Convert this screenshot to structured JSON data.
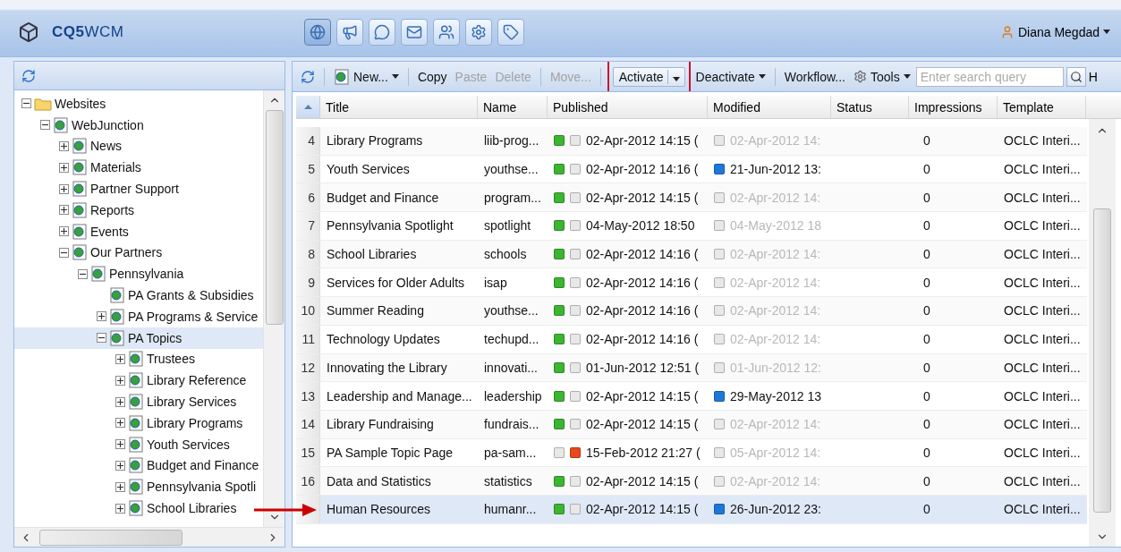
{
  "topbar": {
    "logo": "**CQ5**WCM",
    "apps": [
      {
        "selected": true
      },
      {
        "selected": false
      },
      {
        "selected": false
      },
      {
        "selected": false
      },
      {
        "selected": false
      },
      {
        "selected": false
      },
      {
        "selected": false
      }
    ],
    "user": "Diana Megdad"
  },
  "tree": {
    "nodes": [
      {
        "label": "Websites",
        "kind": "folder",
        "expandable": true,
        "expanded": true,
        "selected": false,
        "children": [
          {
            "label": "WebJunction",
            "kind": "page",
            "expandable": true,
            "expanded": true,
            "selected": false,
            "children": [
              {
                "label": "News",
                "kind": "page",
                "expandable": true,
                "expanded": false,
                "selected": false
              },
              {
                "label": "Materials",
                "kind": "page",
                "expandable": true,
                "expanded": false,
                "selected": false
              },
              {
                "label": "Partner Support",
                "kind": "page",
                "expandable": true,
                "expanded": false,
                "selected": false
              },
              {
                "label": "Reports",
                "kind": "page",
                "expandable": true,
                "expanded": false,
                "selected": false
              },
              {
                "label": "Events",
                "kind": "page",
                "expandable": true,
                "expanded": false,
                "selected": false
              },
              {
                "label": "Our Partners",
                "kind": "page",
                "expandable": true,
                "expanded": true,
                "selected": false,
                "children": [
                  {
                    "label": "Pennsylvania",
                    "kind": "page",
                    "expandable": true,
                    "expanded": true,
                    "selected": false,
                    "children": [
                      {
                        "label": "PA Grants & Subsidies",
                        "kind": "page",
                        "expandable": false,
                        "expanded": false,
                        "selected": false
                      },
                      {
                        "label": "PA Programs & Service",
                        "kind": "page",
                        "expandable": true,
                        "expanded": false,
                        "selected": false
                      },
                      {
                        "label": "PA Topics",
                        "kind": "page",
                        "expandable": true,
                        "expanded": true,
                        "selected": true,
                        "children": [
                          {
                            "label": "Trustees",
                            "kind": "page",
                            "expandable": true,
                            "expanded": false,
                            "selected": false
                          },
                          {
                            "label": "Library Reference",
                            "kind": "page",
                            "expandable": true,
                            "expanded": false,
                            "selected": false
                          },
                          {
                            "label": "Library Services",
                            "kind": "page",
                            "expandable": true,
                            "expanded": false,
                            "selected": false
                          },
                          {
                            "label": "Library Programs",
                            "kind": "page",
                            "expandable": true,
                            "expanded": false,
                            "selected": false
                          },
                          {
                            "label": "Youth Services",
                            "kind": "page",
                            "expandable": true,
                            "expanded": false,
                            "selected": false
                          },
                          {
                            "label": "Budget and Finance",
                            "kind": "page",
                            "expandable": true,
                            "expanded": false,
                            "selected": false
                          },
                          {
                            "label": "Pennsylvania Spotli",
                            "kind": "page",
                            "expandable": true,
                            "expanded": false,
                            "selected": false
                          },
                          {
                            "label": "School Libraries",
                            "kind": "page",
                            "expandable": true,
                            "expanded": false,
                            "selected": false
                          }
                        ]
                      }
                    ]
                  }
                ]
              }
            ]
          }
        ]
      }
    ]
  },
  "toolbar": {
    "groups": [
      [
        {
          "kind": "refresh",
          "disabled": false,
          "highlighted": false
        }
      ],
      [
        {
          "kind": "page-menu",
          "label": "New...",
          "disabled": false,
          "highlighted": false
        }
      ],
      [
        {
          "kind": "button",
          "label": "Copy",
          "disabled": false,
          "highlighted": false
        },
        {
          "kind": "button",
          "label": "Paste",
          "disabled": true,
          "highlighted": false
        },
        {
          "kind": "button",
          "label": "Delete",
          "disabled": true,
          "highlighted": false
        }
      ],
      [
        {
          "kind": "button",
          "label": "Move...",
          "disabled": true,
          "highlighted": false
        }
      ],
      [
        {
          "kind": "split",
          "label": "Activate",
          "disabled": false,
          "highlighted": true
        },
        {
          "kind": "menu",
          "label": "Deactivate",
          "disabled": false,
          "highlighted": false
        }
      ],
      [
        {
          "kind": "button",
          "label": "Workflow...",
          "disabled": false,
          "highlighted": false
        },
        {
          "kind": "gear-menu",
          "label": "Tools",
          "disabled": false,
          "highlighted": false
        }
      ]
    ],
    "search": {
      "placeholder": "Enter search query"
    },
    "cut_label": "H"
  },
  "grid": {
    "columns": [
      "Title",
      "Name",
      "Published",
      "Modified",
      "Status",
      "Impressions",
      "Template"
    ],
    "rows": [
      {
        "number": "4",
        "title": "Library Programs",
        "name": "liib-prog...",
        "published": true,
        "published_date": "02-Apr-2012 14:15 (",
        "modified_pending": false,
        "modified_date": "02-Apr-2012 14:",
        "impressions": "0",
        "template": "OCLC Interi...",
        "selected": false
      },
      {
        "number": "5",
        "title": "Youth Services",
        "name": "youthse...",
        "published": true,
        "published_date": "02-Apr-2012 14:16 (",
        "modified_pending": true,
        "modified_date": "21-Jun-2012 13:",
        "impressions": "0",
        "template": "OCLC Interi...",
        "selected": false
      },
      {
        "number": "6",
        "title": "Budget and Finance",
        "name": "program...",
        "published": true,
        "published_date": "02-Apr-2012 14:15 (",
        "modified_pending": false,
        "modified_date": "02-Apr-2012 14:",
        "impressions": "0",
        "template": "OCLC Interi...",
        "selected": false
      },
      {
        "number": "7",
        "title": "Pennsylvania Spotlight",
        "name": "spotlight",
        "published": true,
        "published_date": "04-May-2012 18:50",
        "modified_pending": false,
        "modified_date": "04-May-2012 18",
        "impressions": "0",
        "template": "OCLC Interi...",
        "selected": false
      },
      {
        "number": "8",
        "title": "School Libraries",
        "name": "schools",
        "published": true,
        "published_date": "02-Apr-2012 14:16 (",
        "modified_pending": false,
        "modified_date": "02-Apr-2012 14:",
        "impressions": "0",
        "template": "OCLC Interi...",
        "selected": false
      },
      {
        "number": "9",
        "title": "Services for Older Adults",
        "name": "isap",
        "published": true,
        "published_date": "02-Apr-2012 14:16 (",
        "modified_pending": false,
        "modified_date": "02-Apr-2012 14:",
        "impressions": "0",
        "template": "OCLC Interi...",
        "selected": false
      },
      {
        "number": "10",
        "title": "Summer Reading",
        "name": "youthse...",
        "published": true,
        "published_date": "02-Apr-2012 14:16 (",
        "modified_pending": false,
        "modified_date": "02-Apr-2012 14:",
        "impressions": "0",
        "template": "OCLC Interi...",
        "selected": false
      },
      {
        "number": "11",
        "title": "Technology Updates",
        "name": "techupd...",
        "published": true,
        "published_date": "02-Apr-2012 14:16 (",
        "modified_pending": false,
        "modified_date": "02-Apr-2012 14:",
        "impressions": "0",
        "template": "OCLC Interi...",
        "selected": false
      },
      {
        "number": "12",
        "title": "Innovating the Library",
        "name": "innovati...",
        "published": true,
        "published_date": "01-Jun-2012 12:51 (",
        "modified_pending": false,
        "modified_date": "01-Jun-2012 12:",
        "impressions": "0",
        "template": "OCLC Interi...",
        "selected": false
      },
      {
        "number": "13",
        "title": "Leadership and Manage...",
        "name": "leadership",
        "published": true,
        "published_date": "02-Apr-2012 14:15 (",
        "modified_pending": true,
        "modified_date": "29-May-2012 13",
        "impressions": "0",
        "template": "OCLC Interi...",
        "selected": false
      },
      {
        "number": "14",
        "title": "Library Fundraising",
        "name": "fundrais...",
        "published": true,
        "published_date": "02-Apr-2012 14:15 (",
        "modified_pending": false,
        "modified_date": "02-Apr-2012 14:",
        "impressions": "0",
        "template": "OCLC Interi...",
        "selected": false
      },
      {
        "number": "15",
        "title": "PA Sample Topic Page",
        "name": "pa-sam...",
        "published": false,
        "published_date": "15-Feb-2012 21:27 (",
        "modified_pending": false,
        "modified_date": "05-Apr-2012 14:",
        "impressions": "0",
        "template": "OCLC Interi...",
        "selected": false
      },
      {
        "number": "16",
        "title": "Data and Statistics",
        "name": "statistics",
        "published": true,
        "published_date": "02-Apr-2012 14:15 (",
        "modified_pending": false,
        "modified_date": "02-Apr-2012 14:",
        "impressions": "0",
        "template": "OCLC Interi...",
        "selected": false
      },
      {
        "title": "Human Resources",
        "name": "humanr...",
        "published": true,
        "published_date": "02-Apr-2012 14:15 (",
        "modified_pending": true,
        "modified_date": "26-Jun-2012 23:",
        "impressions": "0",
        "template": "OCLC Interi...",
        "selected": true
      }
    ]
  }
}
